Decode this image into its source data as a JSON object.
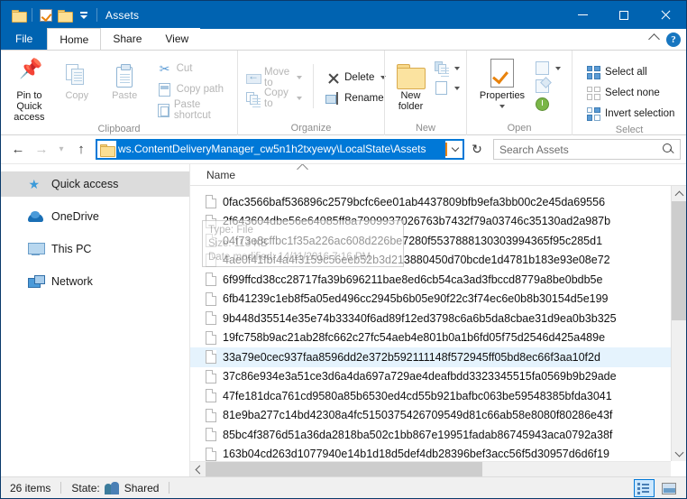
{
  "window": {
    "title": "Assets",
    "quick_access_icons": [
      "folder-icon",
      "properties-check-icon",
      "folder-icon",
      "customize-chevron-icon"
    ],
    "controls": {
      "minimize": "minimize-button",
      "maximize": "maximize-button",
      "close": "close-button"
    }
  },
  "tabs": [
    {
      "label": "File",
      "state": "file"
    },
    {
      "label": "Home",
      "state": "active"
    },
    {
      "label": "Share",
      "state": "normal"
    },
    {
      "label": "View",
      "state": "normal"
    }
  ],
  "ribbon": {
    "groups": [
      {
        "title": "Clipboard",
        "big_buttons": [
          {
            "label": "Pin to Quick\naccess",
            "line1": "Pin to Quick",
            "line2": "access",
            "icon": "pin-icon",
            "disabled": false
          },
          {
            "label": "Copy",
            "icon": "copy-icon",
            "disabled": true
          },
          {
            "label": "Paste",
            "icon": "paste-icon",
            "disabled": true
          }
        ],
        "small_buttons": [
          {
            "label": "Cut",
            "icon": "scissors-icon",
            "disabled": true
          },
          {
            "label": "Copy path",
            "icon": "copy-path-icon",
            "disabled": false
          },
          {
            "label": "Paste shortcut",
            "icon": "paste-shortcut-icon",
            "disabled": false
          }
        ]
      },
      {
        "title": "Organize",
        "small_buttons": [
          {
            "label": "Move to",
            "icon": "move-to-icon",
            "disabled": true,
            "caret": true
          },
          {
            "label": "Copy to",
            "icon": "copy-to-icon",
            "disabled": true,
            "caret": true
          },
          {
            "label": "Delete",
            "icon": "delete-x-icon",
            "disabled": false,
            "caret": true
          },
          {
            "label": "Rename",
            "icon": "rename-icon",
            "disabled": false,
            "caret": false
          }
        ]
      },
      {
        "title": "New",
        "big_buttons": [
          {
            "line1": "New",
            "line2": "folder",
            "icon": "new-folder-icon",
            "disabled": false
          }
        ],
        "small_buttons": [
          {
            "label": "",
            "icon": "new-item-icon",
            "caret": true
          },
          {
            "label": "",
            "icon": "easy-access-icon",
            "caret": true
          }
        ]
      },
      {
        "title": "Open",
        "big_buttons": [
          {
            "line1": "Properties",
            "line2": "",
            "icon": "properties-icon",
            "disabled": false,
            "caret": true
          }
        ],
        "small_buttons": [
          {
            "label": "",
            "icon": "open-icon",
            "caret": true
          },
          {
            "label": "",
            "icon": "edit-icon",
            "caret": false
          },
          {
            "label": "",
            "icon": "history-icon",
            "caret": false
          }
        ]
      },
      {
        "title": "Select",
        "small_buttons": [
          {
            "label": "Select all",
            "icon": "select-all-icon",
            "disabled": false
          },
          {
            "label": "Select none",
            "icon": "select-none-icon",
            "disabled": false
          },
          {
            "label": "Invert selection",
            "icon": "invert-selection-icon",
            "disabled": false
          }
        ]
      }
    ],
    "collapse_icon": "chevron-up-icon",
    "help_icon": "help-icon",
    "help_label": "?"
  },
  "addressbar": {
    "back_icon": "back-arrow-icon",
    "forward_icon": "forward-arrow-icon",
    "recent_icon": "recent-locations-icon",
    "up_icon": "up-arrow-icon",
    "path_value": "ws.ContentDeliveryManager_cw5n1h2txyewy\\LocalState\\Assets",
    "refresh_icon": "refresh-icon",
    "dropdown_icon": "chevron-down-icon"
  },
  "search": {
    "placeholder": "Search Assets",
    "icon": "search-icon"
  },
  "navpane": {
    "items": [
      {
        "label": "Quick access",
        "icon": "quick-access-star-icon",
        "selected": true
      },
      {
        "label": "OneDrive",
        "icon": "onedrive-cloud-icon",
        "selected": false
      },
      {
        "label": "This PC",
        "icon": "this-pc-monitor-icon",
        "selected": false
      },
      {
        "label": "Network",
        "icon": "network-icon",
        "selected": false
      }
    ]
  },
  "filelist": {
    "column_header": "Name",
    "sort_indicator": "sort-ascending-icon",
    "rows": [
      {
        "name": "0fac3566baf536896c2579bcfc6ee01ab4437809bfb9efa3bb00c2e45da69556",
        "selected": false
      },
      {
        "name": "2f643604dbe56e64085ff8a7909937026763b7432f79a03746c35130ad2a987b",
        "selected": false
      },
      {
        "name": "04f73e8cffbc1f35a226ac608d226be7280f5537888130303994365f95c285d1",
        "selected": false
      },
      {
        "name": "4ae0f41fbf4a4f3159c56eeb52b3d213880450d70bcde1d4781b183e93e08e72",
        "selected": false
      },
      {
        "name": "6f99ffcd38cc28717fa39b696211bae8ed6cb54ca3ad3fbccd8779a8be0bdb5e",
        "selected": false
      },
      {
        "name": "6fb41239c1eb8f5a05ed496cc2945b6b05e90f22c3f74ec6e0b8b30154d5e199",
        "selected": false
      },
      {
        "name": "9b448d35514e35e74b33340f6ad89f12ed3798c6a6b5da8cbae31d9ea0b3b325",
        "selected": false
      },
      {
        "name": "19fc758b9ac21ab28fc662c27fc54aeb4e801b0a1b6fd05f75d2546d425a489e",
        "selected": false
      },
      {
        "name": "33a79e0cec937faa8596dd2e372b592111148f572945ff05bd8ec66f3aa10f2d",
        "selected": true
      },
      {
        "name": "37c86e934e3a51ce3d6a4da697a729ae4deafbdd3323345515fa0569b9b29ade",
        "selected": false
      },
      {
        "name": "47fe181dca761cd9580a85b6530ed4cd55b921bafbc063be59548385bfda3041",
        "selected": false
      },
      {
        "name": "81e9ba277c14bd42308a4fc5150375426709549d81c66ab58e8080f80286e43f",
        "selected": false
      },
      {
        "name": "85bc4f3876d51a36da2818ba502c1bb867e19951fadab86745943aca0792a38f",
        "selected": false
      },
      {
        "name": "163b04cd263d1077940e14b1d18d5def4db28396bef3acc56f5d30957d6d6f19",
        "selected": false
      }
    ],
    "tooltip": {
      "type_line": "Type: File",
      "size_line": "Size: 113 KB",
      "date_line": "Date modified: 14/11/2016 7:16 PM"
    }
  },
  "statusbar": {
    "item_count": "26 items",
    "state_label": "State:",
    "state_value": "Shared",
    "state_icon": "shared-people-icon",
    "view_details_icon": "details-view-icon",
    "view_thumbnails_icon": "large-icons-view-icon"
  }
}
